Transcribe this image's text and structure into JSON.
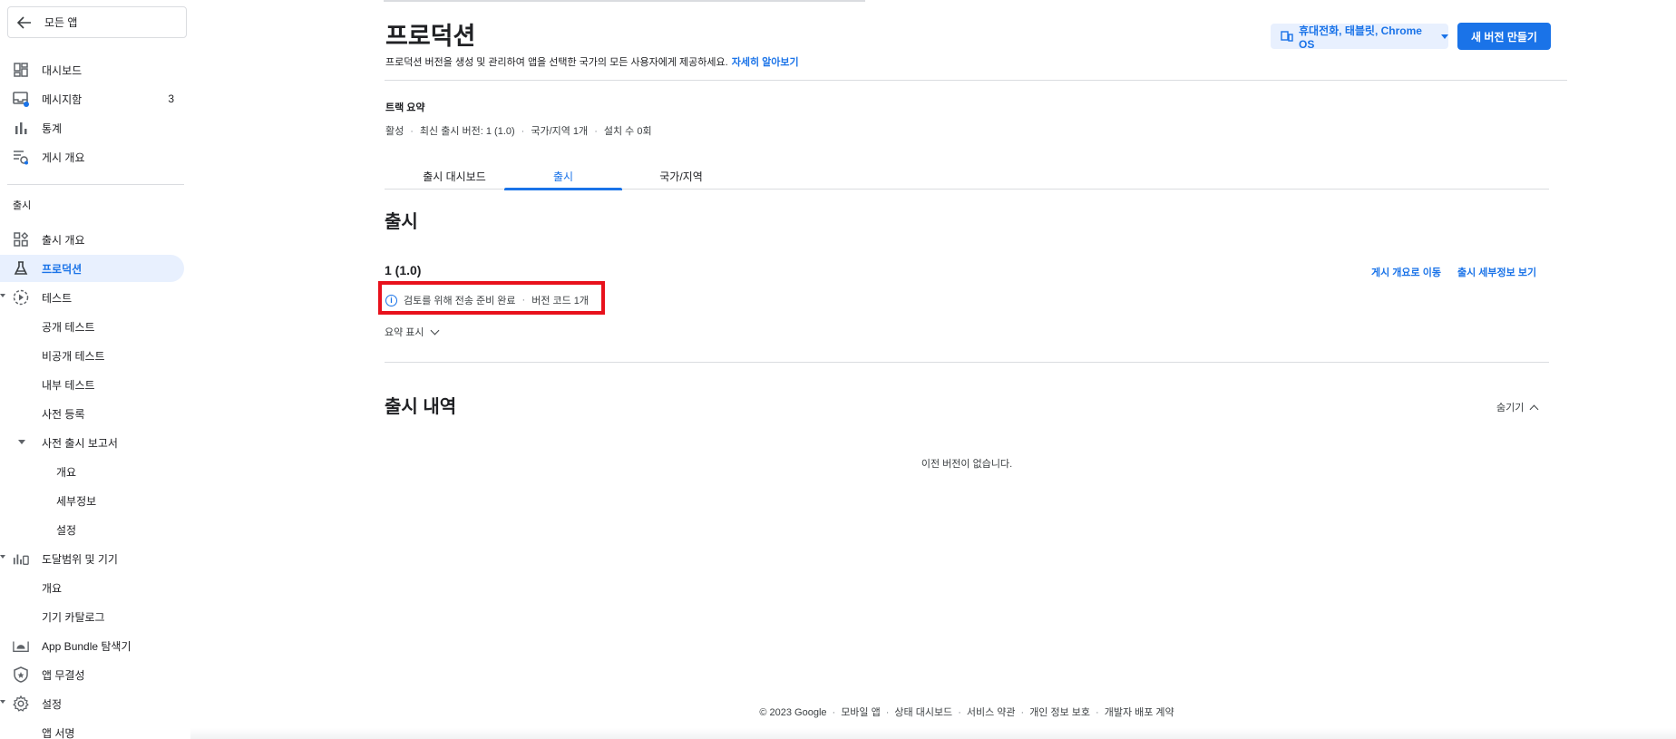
{
  "sidebar": {
    "back_label": "모든 앱",
    "items_top": [
      {
        "label": "대시보드",
        "icon": "dashboard-icon"
      },
      {
        "label": "메시지함",
        "icon": "inbox-icon",
        "count": "3"
      },
      {
        "label": "통계",
        "icon": "bar-chart-icon"
      },
      {
        "label": "게시 개요",
        "icon": "publishing-overview-icon"
      }
    ],
    "section_release": "출시",
    "items_release": [
      {
        "label": "출시 개요"
      },
      {
        "label": "프로덕션"
      },
      {
        "label": "테스트"
      },
      {
        "label": "공개 테스트"
      },
      {
        "label": "비공개 테스트"
      },
      {
        "label": "내부 테스트"
      },
      {
        "label": "사전 등록"
      },
      {
        "label": "사전 출시 보고서"
      },
      {
        "label": "개요"
      },
      {
        "label": "세부정보"
      },
      {
        "label": "설정"
      },
      {
        "label": "도달범위 및 기기"
      },
      {
        "label": "개요"
      },
      {
        "label": "기기 카탈로그"
      },
      {
        "label": "App Bundle 탐색기"
      },
      {
        "label": "앱 무결성"
      },
      {
        "label": "설정"
      },
      {
        "label": "앱 서명"
      }
    ]
  },
  "header": {
    "title": "프로덕션",
    "description": "프로덕션 버전을 생성 및 관리하여 앱을 선택한 국가의 모든 사용자에게 제공하세요.",
    "learn_more": "자세히 알아보기",
    "device_selector": "휴대전화, 태블릿, Chrome OS",
    "new_release_button": "새 버전 만들기"
  },
  "track_summary": {
    "title": "트랙 요약",
    "items": [
      "활성",
      "최신 출시 버전: 1 (1.0)",
      "국가/지역 1개",
      "설치 수 0회"
    ]
  },
  "tabs": [
    {
      "label": "출시 대시보드"
    },
    {
      "label": "출시"
    },
    {
      "label": "국가/지역"
    }
  ],
  "releases": {
    "section_title": "출시",
    "release_name": "1 (1.0)",
    "status": "검토를 위해 전송 준비 완료",
    "version_codes": "버전 코드 1개",
    "show_summary": "요약 표시",
    "link_overview": "게시 개요로 이동",
    "link_details": "출시 세부정보 보기"
  },
  "history": {
    "title": "출시 내역",
    "hide_label": "숨기기",
    "empty": "이전 버전이 없습니다."
  },
  "footer": {
    "copyright": "© 2023 Google",
    "links": [
      "모바일 앱",
      "상태 대시보드",
      "서비스 약관",
      "개인 정보 보호",
      "개발자 배포 계약"
    ]
  },
  "colors": {
    "accent": "#1a73e8",
    "highlight_box": "#e8111c",
    "active_nav_bg": "#e8f0fe"
  }
}
